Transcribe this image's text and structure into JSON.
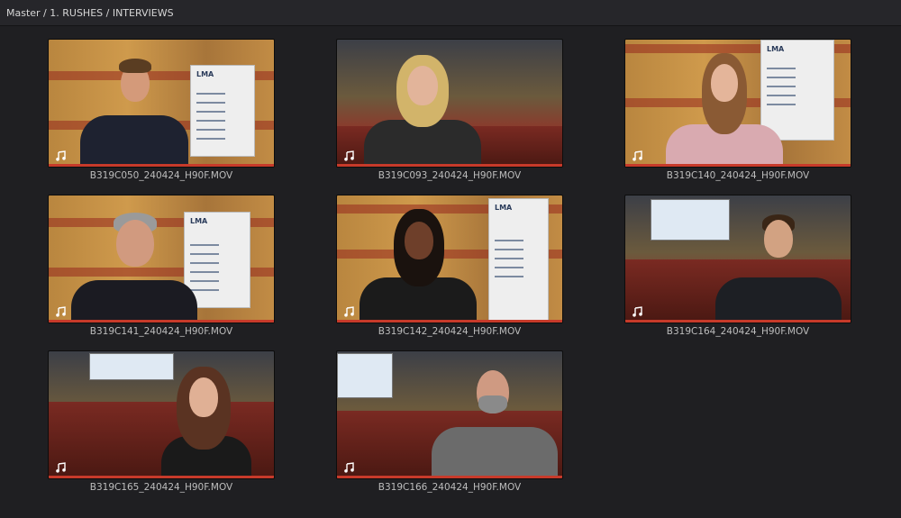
{
  "breadcrumb": "Master / 1. RUSHES / INTERVIEWS",
  "icon": "audio-note-icon",
  "accent_color": "#c73a2a",
  "banner_text": "LMA",
  "clips": [
    {
      "name": "B319C050_240424_H90F.MOV"
    },
    {
      "name": "B319C093_240424_H90F.MOV"
    },
    {
      "name": "B319C140_240424_H90F.MOV"
    },
    {
      "name": "B319C141_240424_H90F.MOV"
    },
    {
      "name": "B319C142_240424_H90F.MOV"
    },
    {
      "name": "B319C164_240424_H90F.MOV"
    },
    {
      "name": "B319C165_240424_H90F.MOV"
    },
    {
      "name": "B319C166_240424_H90F.MOV"
    }
  ]
}
